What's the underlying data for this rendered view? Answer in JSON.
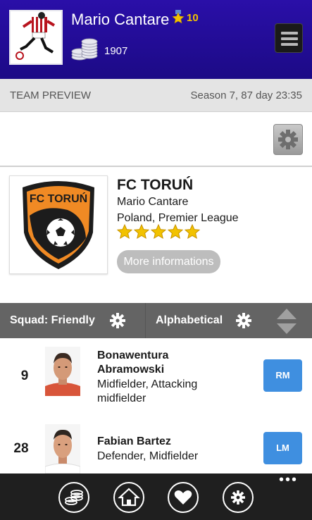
{
  "header": {
    "manager_name": "Mario Cantare",
    "level": "10",
    "coins": "1907"
  },
  "section": {
    "title": "TEAM PREVIEW",
    "season": "Season 7, 87 day 23:35"
  },
  "team": {
    "name": "FC TORUŃ",
    "manager": "Mario Cantare",
    "league": "Poland, Premier League",
    "stars": 5,
    "logo_text": "FC TORUŃ",
    "more_label": "More informations"
  },
  "squad_bar": {
    "squad_label": "Squad: Friendly",
    "sort_label": "Alphabetical"
  },
  "players": [
    {
      "number": "9",
      "name_line1": "Bonawentura",
      "name_line2": "Abramowski",
      "pos_line1": "Midfielder, Attacking",
      "pos_line2": "midfielder",
      "badge": "RM"
    },
    {
      "number": "28",
      "name_line1": "Fabian Bartez",
      "pos_line1": "Defender, Midfielder",
      "badge": "LM"
    }
  ],
  "colors": {
    "header_bg": "#2a0fa8",
    "level_gold": "#f2c200",
    "badge_blue": "#3f8fe0",
    "toolbar_gray": "#646464",
    "app_bar": "#1f1f1f"
  },
  "icons": {
    "avatar": "footballer-avatar-icon",
    "badge": "star-badge-icon",
    "coins": "coins-icon",
    "menu": "menu-icon",
    "settings": "gear-icon",
    "sort": "sort-arrows-icon",
    "app_bar": [
      "coins-icon",
      "home-icon",
      "heart-icon",
      "gear-icon"
    ]
  }
}
